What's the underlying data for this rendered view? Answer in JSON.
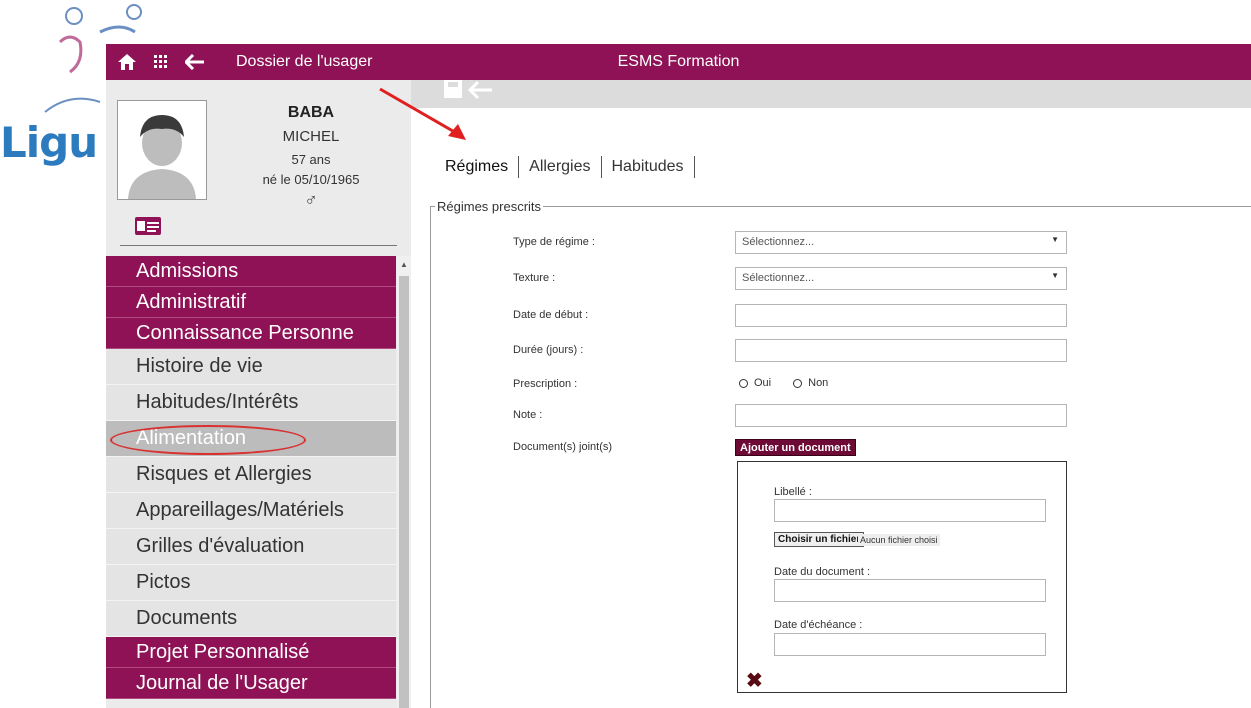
{
  "background_logo": {
    "text": "Ligu"
  },
  "topbar": {
    "title": "Dossier de l'usager",
    "app_name": "ESMS Formation",
    "icons": [
      "home-icon",
      "grid-icon",
      "back-arrow-icon"
    ],
    "color": "#8e1255"
  },
  "patient": {
    "last_name": "BABA",
    "first_name": "MICHEL",
    "age": "57 ans",
    "birth": "né le 05/10/1965",
    "sex_symbol": "♂"
  },
  "menu": {
    "items": [
      {
        "label": "Admissions",
        "style": "section"
      },
      {
        "label": "Administratif",
        "style": "section"
      },
      {
        "label": "Connaissance Personne",
        "style": "section"
      },
      {
        "label": "Histoire de vie",
        "style": "sub"
      },
      {
        "label": "Habitudes/Intérêts",
        "style": "sub"
      },
      {
        "label": "Alimentation",
        "style": "active"
      },
      {
        "label": "Risques et Allergies",
        "style": "sub"
      },
      {
        "label": "Appareillages/Matériels",
        "style": "sub"
      },
      {
        "label": "Grilles d'évaluation",
        "style": "sub"
      },
      {
        "label": "Pictos",
        "style": "sub"
      },
      {
        "label": "Documents",
        "style": "sub"
      },
      {
        "label": "Projet Personnalisé",
        "style": "section"
      },
      {
        "label": "Journal de l'Usager",
        "style": "section"
      }
    ]
  },
  "tabs": [
    {
      "label": "Régimes",
      "active": true
    },
    {
      "label": "Allergies",
      "active": false
    },
    {
      "label": "Habitudes",
      "active": false
    }
  ],
  "form": {
    "legend": "Régimes prescrits",
    "type_label": "Type de régime :",
    "type_value": "Sélectionnez...",
    "texture_label": "Texture :",
    "texture_value": "Sélectionnez...",
    "start_label": "Date de début :",
    "start_value": "",
    "duration_label": "Durée (jours) :",
    "duration_value": "",
    "prescription_label": "Prescription :",
    "prescription_yes": "Oui",
    "prescription_no": "Non",
    "note_label": "Note :",
    "note_value": "",
    "docs_label": "Document(s) joint(s)",
    "add_doc_button": "Ajouter un document"
  },
  "document": {
    "libelle_label": "Libellé :",
    "libelle_value": "",
    "file_button": "Choisir un fichier",
    "file_status": "Aucun fichier choisi",
    "date_label": "Date du document :",
    "date_value": "",
    "due_label": "Date d'échéance :",
    "due_value": ""
  }
}
